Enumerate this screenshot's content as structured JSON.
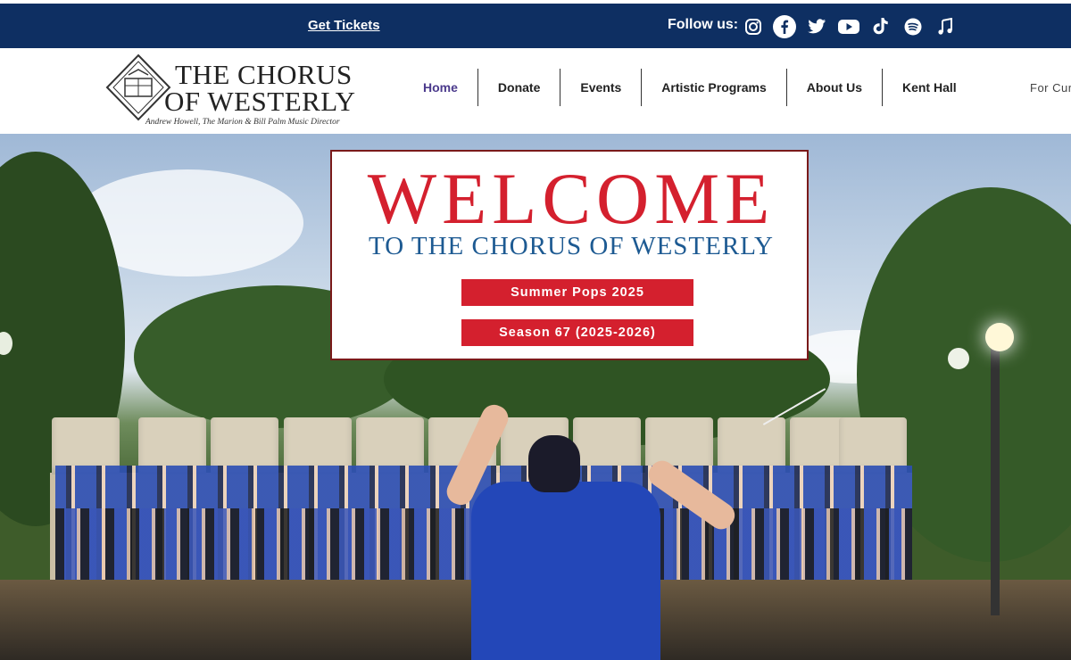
{
  "topbar": {
    "get_tickets": "Get Tickets",
    "follow_label": "Follow us:",
    "social_icons": [
      "instagram-icon",
      "facebook-icon",
      "twitter-icon",
      "youtube-icon",
      "tiktok-icon",
      "spotify-icon",
      "music-note-icon"
    ],
    "background": "#0e2f62"
  },
  "logo": {
    "line1": "THE CHORUS",
    "line2": "OF WESTERLY",
    "subtitle": "Andrew Howell, The Marion & Bill Palm Music Director"
  },
  "nav": {
    "items": [
      "Home",
      "Donate",
      "Events",
      "Artistic Programs",
      "About Us",
      "Kent Hall"
    ],
    "active": "Home",
    "overflow_text": "For Cur"
  },
  "welcome": {
    "title": "WELCOME",
    "subtitle": "TO THE CHORUS OF WESTERLY",
    "buttons": [
      "Summer Pops 2025",
      "Season 67 (2025-2026)"
    ],
    "title_color": "#d4202e",
    "subtitle_color": "#1d5a92"
  }
}
